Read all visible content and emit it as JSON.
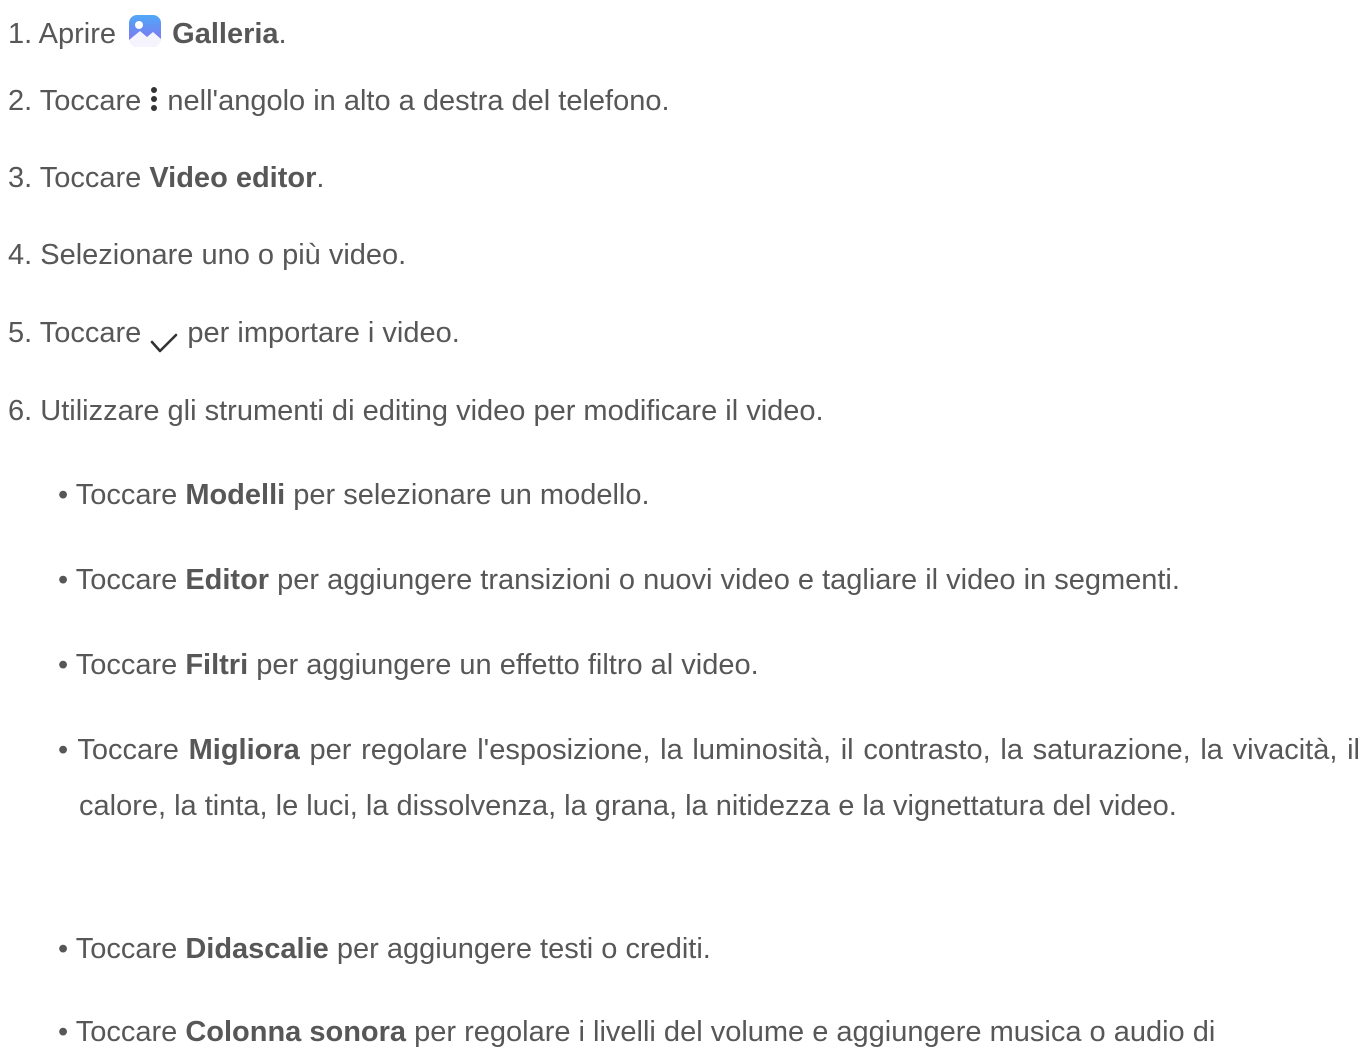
{
  "steps": [
    {
      "num": "1.",
      "pre": "Aprire",
      "icon": "gallery-app-icon",
      "bold": "Galleria",
      "post": "."
    },
    {
      "num": "2.",
      "pre": "Toccare",
      "icon": "more-vertical-icon",
      "post": "nell'angolo in alto a destra del telefono."
    },
    {
      "num": "3.",
      "pre": "Toccare",
      "bold": "Video editor",
      "post": "."
    },
    {
      "num": "4.",
      "text": "Selezionare uno o più video."
    },
    {
      "num": "5.",
      "pre": "Toccare",
      "icon": "checkmark-icon",
      "post": "per importare i video."
    },
    {
      "num": "6.",
      "text": "Utilizzare gli strumenti di editing video per modificare il video."
    }
  ],
  "bullets": [
    {
      "pre": "Toccare",
      "bold": "Modelli",
      "post": "per selezionare un modello."
    },
    {
      "pre": "Toccare",
      "bold": "Editor",
      "post": "per aggiungere transizioni o nuovi video e tagliare il video in segmenti."
    },
    {
      "pre": "Toccare",
      "bold": "Filtri",
      "post": "per aggiungere un effetto filtro al video."
    },
    {
      "pre": "Toccare",
      "bold": "Migliora",
      "post": "per regolare l'esposizione, la luminosità, il contrasto, la saturazione, la vivacità, il calore, la tinta, le luci, la dissolvenza, la grana, la nitidezza e la vignettatura del video."
    },
    {
      "pre": "Toccare",
      "bold": "Didascalie",
      "post": "per aggiungere testi o crediti."
    },
    {
      "pre": "Toccare",
      "bold": "Colonna sonora",
      "post": "per regolare i livelli del volume e aggiungere musica o audio di"
    }
  ],
  "bullet_char": "•",
  "colors": {
    "text": "#575757",
    "gallery_icon_top": "#4fa8f7",
    "gallery_icon_bottom": "#8b6cf0"
  }
}
